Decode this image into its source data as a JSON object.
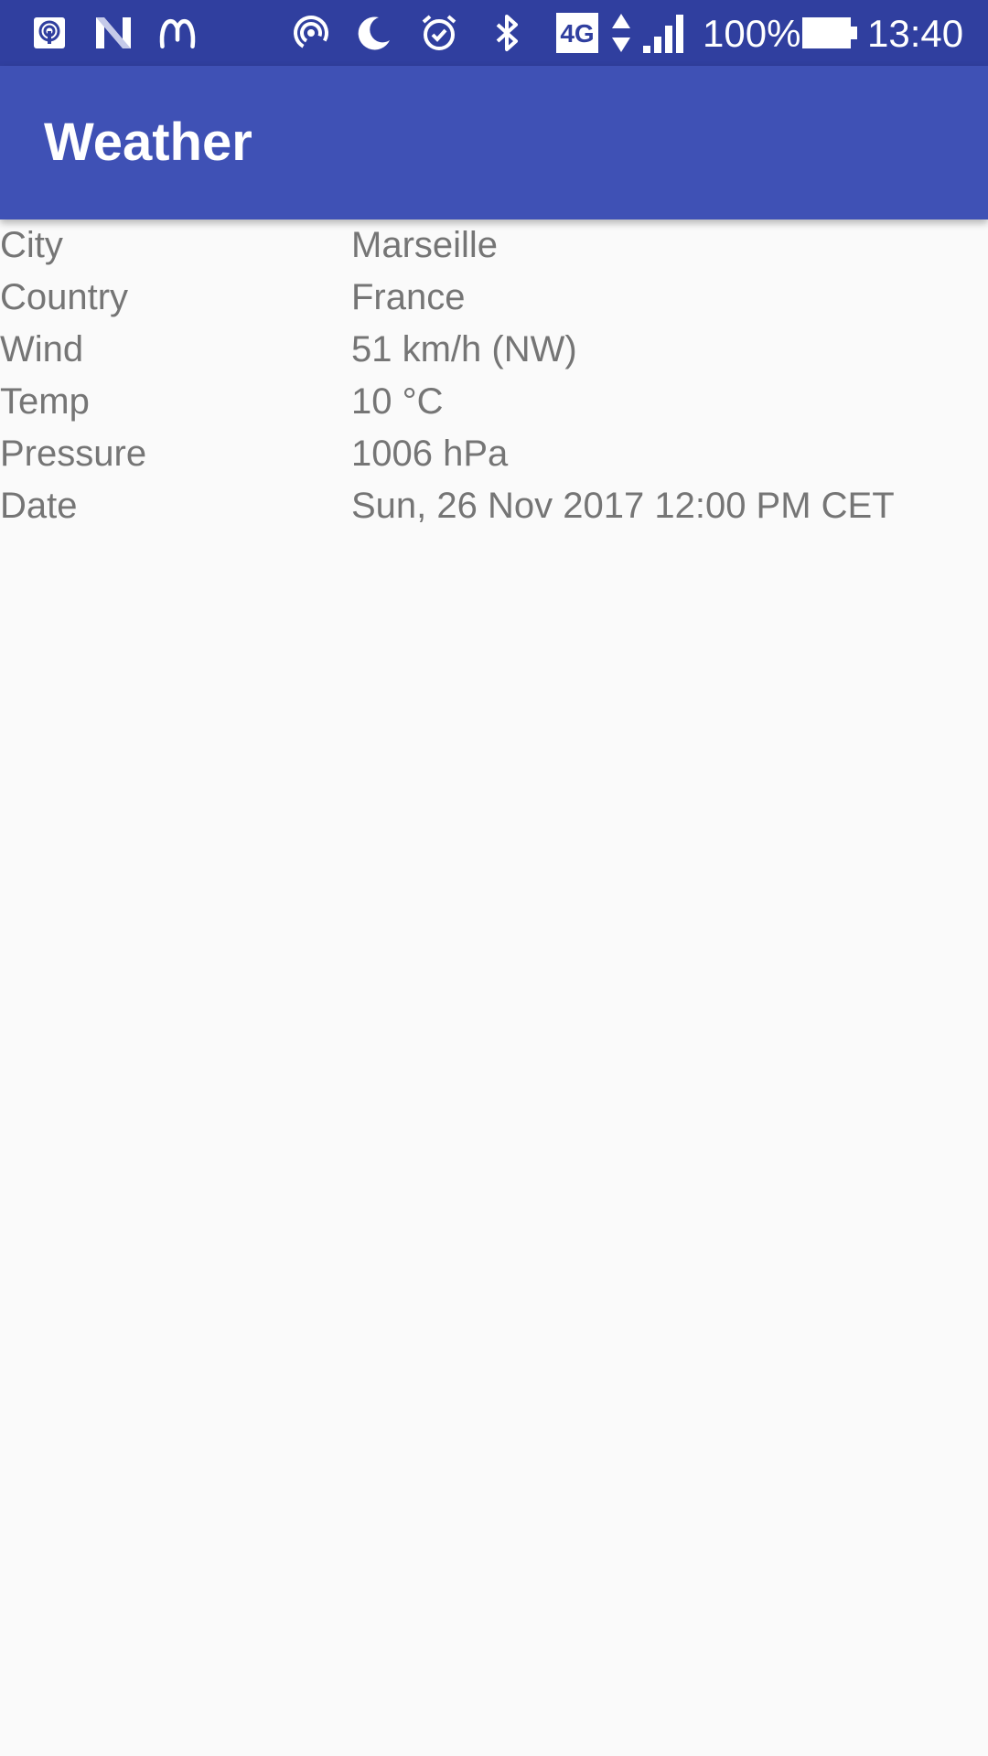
{
  "status_bar": {
    "icons": [
      "podcast-cast-icon",
      "n-app-icon",
      "mastodon-icon",
      "hotspot-icon",
      "moon-icon",
      "alarm-icon",
      "bluetooth-icon",
      "4g-icon",
      "data-arrows-icon",
      "signal-icon",
      "battery-icon"
    ],
    "network_type": "4G",
    "battery": "100%",
    "time": "13:40",
    "colors": {
      "background": "#303f9f"
    }
  },
  "app_bar": {
    "title": "Weather",
    "colors": {
      "background": "#3f51b5",
      "title": "#ffffff"
    }
  },
  "weather": {
    "rows": [
      {
        "label": "City",
        "value": "Marseille"
      },
      {
        "label": "Country",
        "value": "France"
      },
      {
        "label": "Wind",
        "value": "51 km/h (NW)"
      },
      {
        "label": "Temp",
        "value": "10 °C"
      },
      {
        "label": "Pressure",
        "value": "1006 hPa"
      },
      {
        "label": "Date",
        "value": "Sun, 26 Nov 2017 12:00 PM CET"
      }
    ],
    "colors": {
      "text": "#757575",
      "background": "#fafafa"
    }
  }
}
